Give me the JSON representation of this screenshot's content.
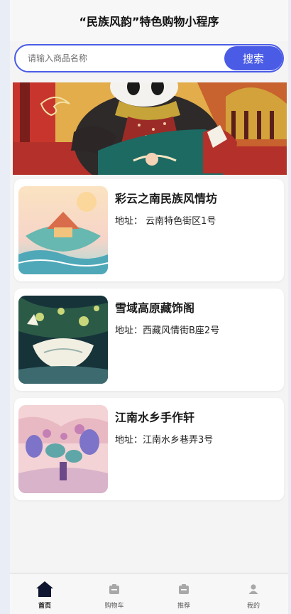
{
  "header": {
    "title": "“民族风韵”特色购物小程序"
  },
  "search": {
    "placeholder": "请输入商品名称",
    "button_label": "搜索"
  },
  "shops": [
    {
      "name": "彩云之南民族风情坊",
      "address": "地址：  云南特色街区1号"
    },
    {
      "name": "雪域高原藏饰阁",
      "address": "地址：西藏风情街B座2号"
    },
    {
      "name": "江南水乡手作轩",
      "address": "地址：江南水乡巷弄3号"
    }
  ],
  "tabbar": {
    "items": [
      {
        "label": "首页",
        "icon": "home-icon",
        "active": true
      },
      {
        "label": "购物车",
        "icon": "cart-icon",
        "active": false
      },
      {
        "label": "推荐",
        "icon": "recommend-icon",
        "active": false
      },
      {
        "label": "我的",
        "icon": "profile-icon",
        "active": false
      }
    ]
  },
  "colors": {
    "accent": "#4a5ce6",
    "active_tab": "#0d1530"
  }
}
